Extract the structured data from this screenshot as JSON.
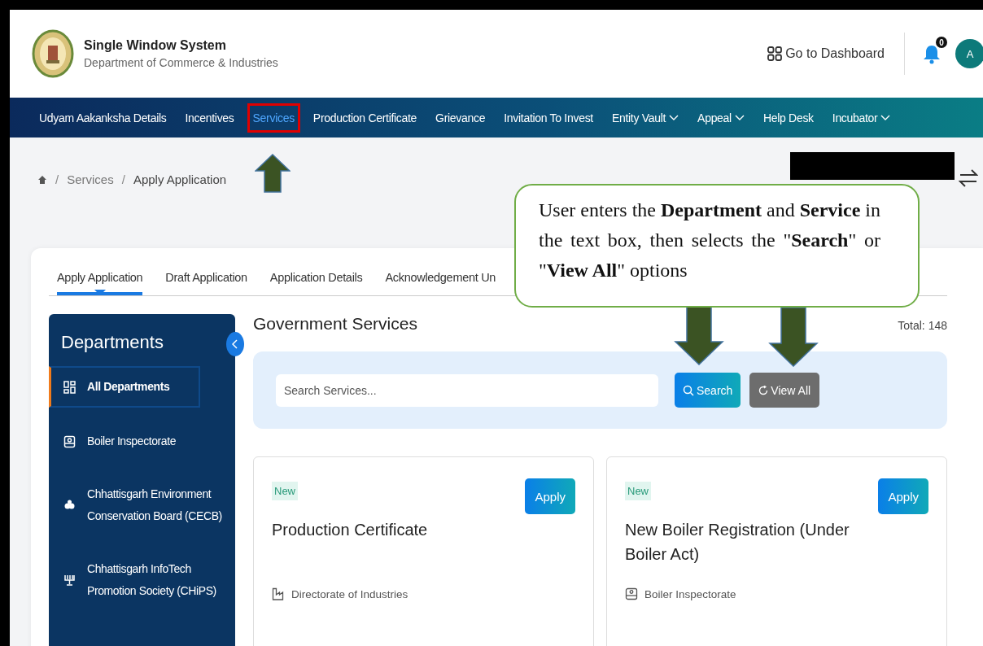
{
  "header": {
    "title": "Single Window System",
    "subtitle": "Department of Commerce & Industries",
    "dashboard_link": "Go to Dashboard",
    "notification_count": "0",
    "avatar": "A"
  },
  "nav": [
    {
      "label": "Udyam Aakanksha Details",
      "dropdown": false,
      "highlighted": false
    },
    {
      "label": "Incentives",
      "dropdown": false,
      "highlighted": false
    },
    {
      "label": "Services",
      "dropdown": false,
      "highlighted": true
    },
    {
      "label": "Production Certificate",
      "dropdown": false,
      "highlighted": false
    },
    {
      "label": "Grievance",
      "dropdown": false,
      "highlighted": false
    },
    {
      "label": "Invitation To Invest",
      "dropdown": false,
      "highlighted": false
    },
    {
      "label": "Entity Vault",
      "dropdown": true,
      "highlighted": false
    },
    {
      "label": "Appeal",
      "dropdown": true,
      "highlighted": false
    },
    {
      "label": "Help Desk",
      "dropdown": false,
      "highlighted": false
    },
    {
      "label": "Incubator",
      "dropdown": true,
      "highlighted": false
    }
  ],
  "breadcrumb": {
    "separator": "/",
    "items": [
      "Services",
      "Apply Application"
    ]
  },
  "tabs": [
    {
      "label": "Apply Application",
      "selected": true
    },
    {
      "label": "Draft Application",
      "selected": false
    },
    {
      "label": "Application Details",
      "selected": false
    },
    {
      "label": "Acknowledgement Un",
      "selected": false
    }
  ],
  "sidebar": {
    "title": "Departments",
    "items": [
      {
        "label": "All Departments",
        "selected": true
      },
      {
        "label": "Boiler Inspectorate",
        "selected": false
      },
      {
        "label": "Chhattisgarh Environment Conservation Board (CECB)",
        "selected": false
      },
      {
        "label": "Chhattisgarh InfoTech Promotion Society (CHiPS)",
        "selected": false
      }
    ]
  },
  "main": {
    "title": "Government Services",
    "total": "Total: 148",
    "search": {
      "placeholder": "Search Services...",
      "search_button": "Search",
      "view_all_button": "View All"
    },
    "services": [
      {
        "badge": "New",
        "title": "Production Certificate",
        "department": "Directorate of Industries",
        "action": "Apply"
      },
      {
        "badge": "New",
        "title": "New Boiler Registration (Under Boiler Act)",
        "department": "Boiler Inspectorate",
        "action": "Apply"
      }
    ]
  },
  "callout": {
    "text": "User enters the **Department** and **Service** in the text box, then selects the \"**Search**\" or \"**View All**\" options"
  }
}
